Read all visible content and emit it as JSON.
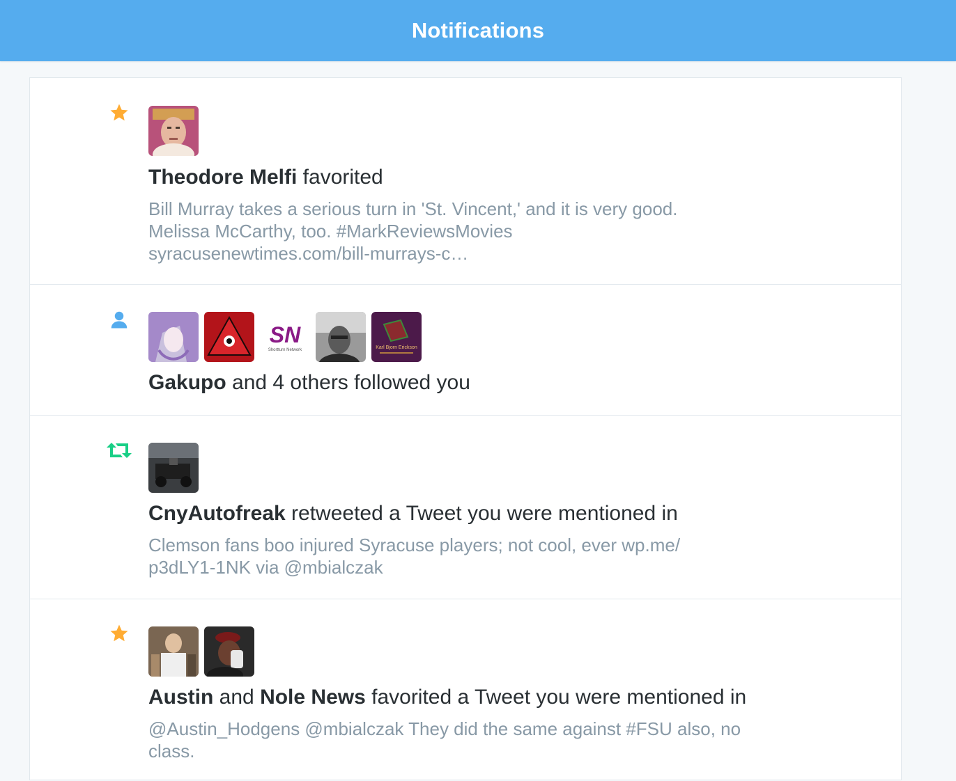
{
  "header": {
    "title": "Notifications"
  },
  "notifications": [
    {
      "type": "favorite",
      "icon": "star-icon",
      "actor": "Theodore Melfi",
      "action": " favorited",
      "snippet_lines": [
        "Bill Murray takes a serious turn in 'St. Vincent,' and it is very good.",
        "Melissa McCarthy, too. #MarkReviewsMovies",
        "syracusenewtimes.com/bill-murrays-c…"
      ]
    },
    {
      "type": "follow",
      "icon": "person-icon",
      "actor": "Gakupo",
      "action": " and 4 others followed you",
      "avatar_labels": [
        "SN",
        "Shortturn Network",
        "Karl Bjorn Erickson"
      ]
    },
    {
      "type": "retweet",
      "icon": "retweet-icon",
      "actor": "CnyAutofreak",
      "action": " retweeted a Tweet you were mentioned in",
      "snippet_lines": [
        "Clemson fans boo injured Syracuse players; not cool, ever wp.me/",
        "p3dLY1-1NK via @mbialczak"
      ]
    },
    {
      "type": "favorite",
      "icon": "star-icon",
      "actor": "Austin",
      "joiner": " and ",
      "actor2": "Nole News",
      "action": " favorited a Tweet you were mentioned in",
      "snippet_lines": [
        "@Austin_Hodgens @mbialczak They did the same against #FSU also, no",
        "class."
      ]
    }
  ],
  "colors": {
    "brand": "#55acee",
    "favorite": "#ffac33",
    "retweet": "#19cf86",
    "follow": "#55acee",
    "muted_text": "#8899a6",
    "primary_text": "#292f33"
  }
}
